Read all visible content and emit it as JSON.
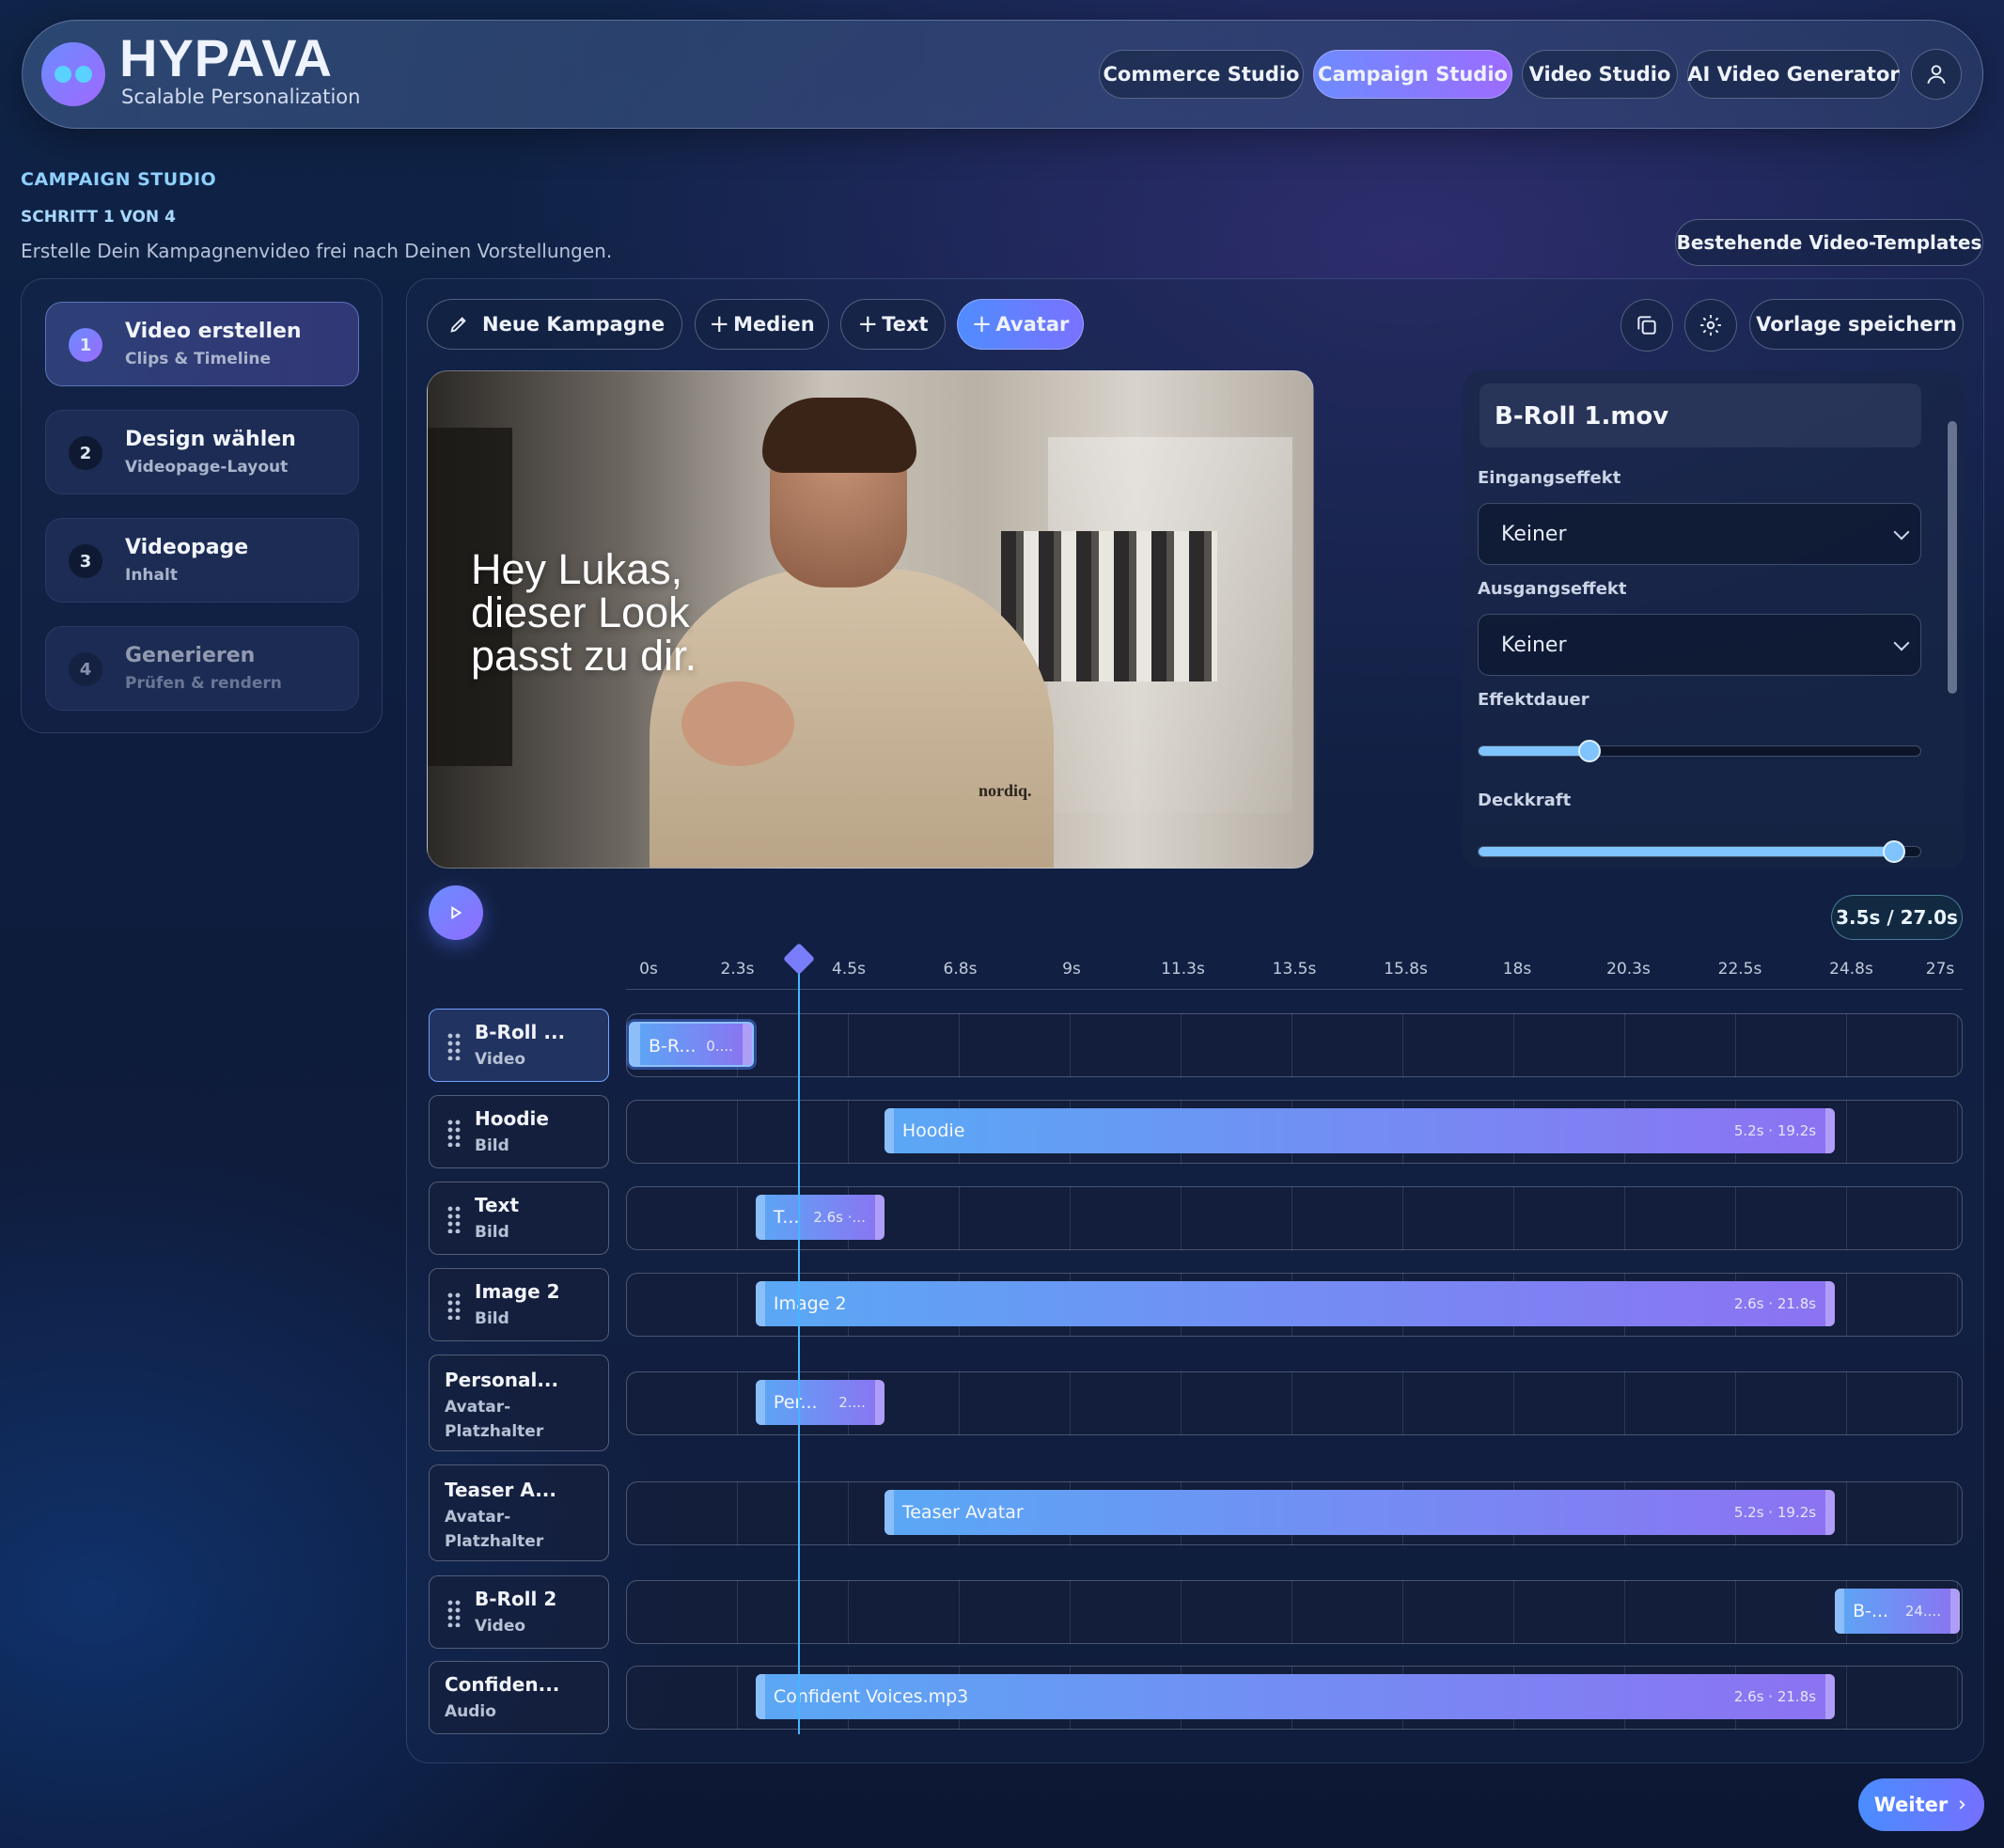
{
  "app": {
    "brand": "HYPAVA",
    "tagline": "Scalable Personalization"
  },
  "nav": {
    "items": [
      "Commerce Studio",
      "Campaign Studio",
      "Video Studio",
      "AI Video Generator"
    ],
    "active": "Campaign Studio",
    "profile_icon": "user-icon"
  },
  "page": {
    "section": "CAMPAIGN STUDIO",
    "step_indicator": "SCHRITT 1 VON 4",
    "intro": "Erstelle Dein Kampagnenvideo frei nach Deinen Vorstellungen.",
    "templates_button": "Bestehende Video-Templates"
  },
  "steps": [
    {
      "num": "1",
      "title": "Video erstellen",
      "sub": "Clips & Timeline",
      "state": "active"
    },
    {
      "num": "2",
      "title": "Design wählen",
      "sub": "Videopage-Layout",
      "state": "default"
    },
    {
      "num": "3",
      "title": "Videopage",
      "sub": "Inhalt",
      "state": "default"
    },
    {
      "num": "4",
      "title": "Generieren",
      "sub": "Prüfen & rendern",
      "state": "disabled"
    }
  ],
  "toolbar": {
    "new_campaign": "Neue Kampagne",
    "add_media": "Medien",
    "add_text": "Text",
    "add_avatar": "Avatar",
    "plus": "+",
    "save_template": "Vorlage speichern",
    "icons": [
      "pencil-icon",
      "duplicate-icon",
      "gear-icon"
    ]
  },
  "preview": {
    "overlay_lines": [
      "Hey Lukas,",
      "dieser Look",
      "passt zu dir."
    ],
    "shirt_logo": "nordiq."
  },
  "properties": {
    "title": "B-Roll 1.mov",
    "entry_label": "Eingangseffekt",
    "entry_value": "Keiner",
    "exit_label": "Ausgangseffekt",
    "exit_value": "Keiner",
    "duration_label": "Effektdauer",
    "duration_level": 0.25,
    "opacity_label": "Deckkraft",
    "opacity_level": 0.94
  },
  "playback": {
    "time": "3.5s / 27.0s",
    "playhead_seconds": 3.5,
    "total_seconds": 27
  },
  "timeline": {
    "ticks": [
      "0s",
      "2.3s",
      "4.5s",
      "6.8s",
      "9s",
      "11.3s",
      "13.5s",
      "15.8s",
      "18s",
      "20.3s",
      "22.5s",
      "24.8s",
      "27s"
    ],
    "tracks": [
      {
        "name": "B-Roll ...",
        "kind": "Video",
        "grip": true,
        "selected": true,
        "clip": {
          "label": "B-R...",
          "time": "0....",
          "start": 0,
          "end": 2.6
        }
      },
      {
        "name": "Hoodie",
        "kind": "Bild",
        "grip": true,
        "clip": {
          "label": "Hoodie",
          "time": "5.2s · 19.2s",
          "start": 5.2,
          "end": 24.4
        }
      },
      {
        "name": "Text",
        "kind": "Bild",
        "grip": true,
        "clip": {
          "label": "T...",
          "time": "2.6s ·...",
          "start": 2.6,
          "end": 5.2
        }
      },
      {
        "name": "Image 2",
        "kind": "Bild",
        "grip": true,
        "clip": {
          "label": "Image 2",
          "time": "2.6s · 21.8s",
          "start": 2.6,
          "end": 24.4
        }
      },
      {
        "name": "Personal...",
        "kind": "Avatar-\nPlatzhalter",
        "grip": false,
        "clip": {
          "label": "Per...",
          "time": "2....",
          "start": 2.6,
          "end": 5.2
        }
      },
      {
        "name": "Teaser A...",
        "kind": "Avatar-\nPlatzhalter",
        "grip": false,
        "clip": {
          "label": "Teaser Avatar",
          "time": "5.2s · 19.2s",
          "start": 5.2,
          "end": 24.4
        }
      },
      {
        "name": "B-Roll 2",
        "kind": "Video",
        "grip": true,
        "clip": {
          "label": "B-...",
          "time": "24....",
          "start": 24.4,
          "end": 27
        }
      },
      {
        "name": "Confiden...",
        "kind": "Audio",
        "grip": false,
        "clip": {
          "label": "Confident Voices.mp3",
          "time": "2.6s · 21.8s",
          "start": 2.6,
          "end": 24.4
        }
      }
    ]
  },
  "footer": {
    "next": "Weiter"
  },
  "colors": {
    "accent": "#7a7dfa",
    "playhead": "#45b6ff",
    "clip_start": "#5aa8f5",
    "clip_end": "#8c72f2"
  }
}
